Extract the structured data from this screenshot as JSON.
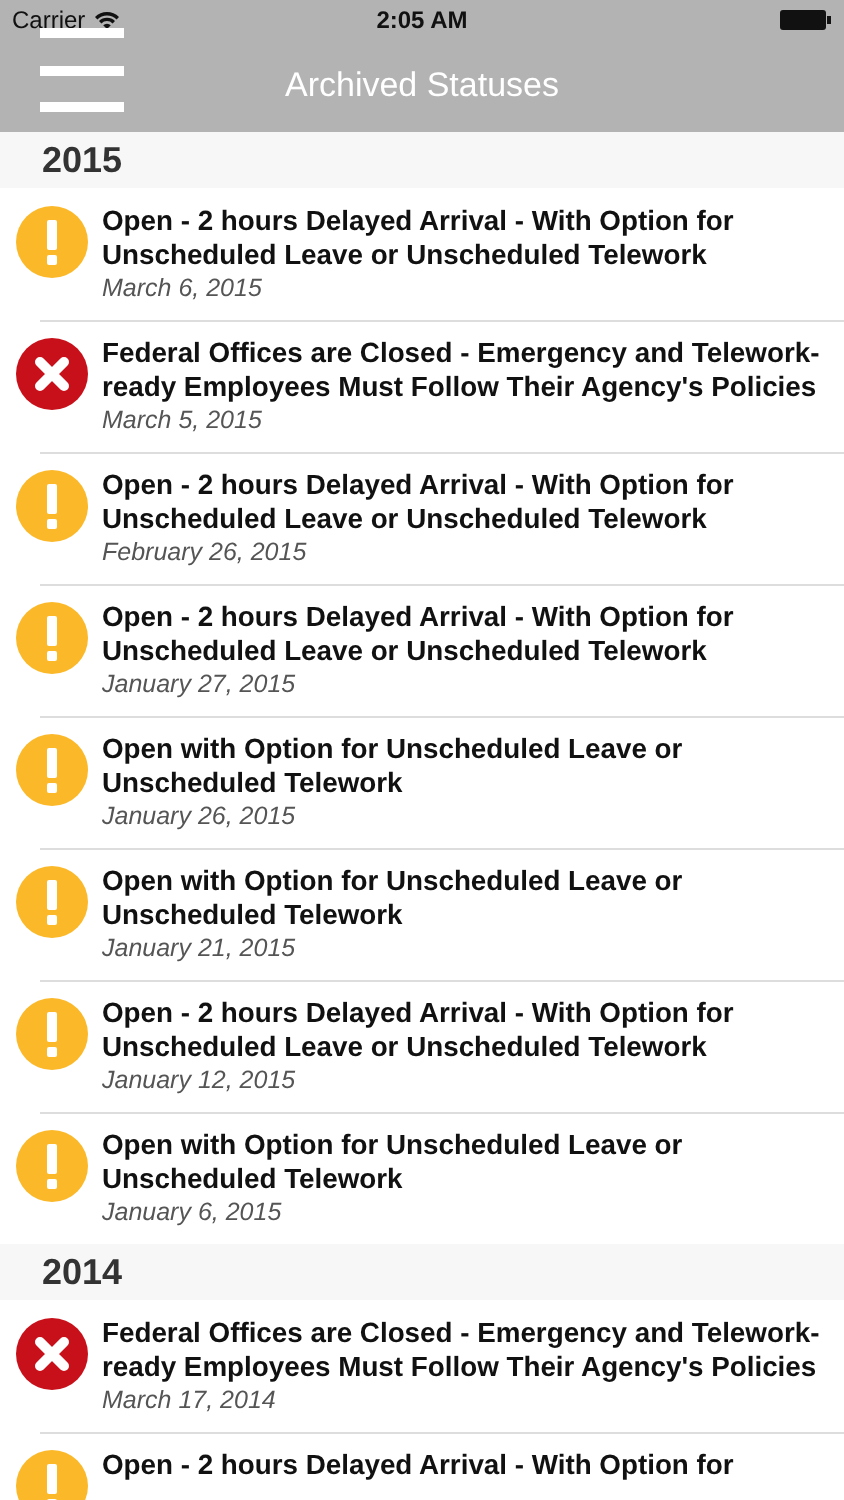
{
  "status_bar": {
    "carrier": "Carrier",
    "time": "2:05 AM"
  },
  "nav_bar": {
    "title": "Archived Statuses"
  },
  "sections": [
    {
      "year": "2015",
      "items": [
        {
          "kind": "warning",
          "title": "Open - 2 hours Delayed Arrival - With Option for Unscheduled Leave or Unscheduled Telework",
          "date": "March 6, 2015"
        },
        {
          "kind": "closed",
          "title": "Federal Offices are Closed - Emergency and Telework-ready Employees Must Follow Their Agency's Policies",
          "date": "March 5, 2015"
        },
        {
          "kind": "warning",
          "title": "Open - 2 hours Delayed Arrival - With Option for Unscheduled Leave or Unscheduled Telework",
          "date": "February 26, 2015"
        },
        {
          "kind": "warning",
          "title": "Open - 2 hours Delayed Arrival - With Option for Unscheduled Leave or Unscheduled Telework",
          "date": "January 27, 2015"
        },
        {
          "kind": "warning",
          "title": "Open with Option for Unscheduled Leave or Unscheduled Telework",
          "date": "January 26, 2015"
        },
        {
          "kind": "warning",
          "title": "Open with Option for Unscheduled Leave or Unscheduled Telework",
          "date": "January 21, 2015"
        },
        {
          "kind": "warning",
          "title": "Open - 2 hours Delayed Arrival - With Option for Unscheduled Leave or Unscheduled Telework",
          "date": "January 12, 2015"
        },
        {
          "kind": "warning",
          "title": "Open with Option for Unscheduled Leave or Unscheduled Telework",
          "date": "January 6, 2015"
        }
      ]
    },
    {
      "year": "2014",
      "items": [
        {
          "kind": "closed",
          "title": "Federal Offices are Closed - Emergency and Telework-ready Employees Must Follow Their Agency's Policies",
          "date": "March 17, 2014"
        },
        {
          "kind": "warning",
          "title": "Open - 2 hours Delayed Arrival - With Option for"
        }
      ]
    }
  ]
}
